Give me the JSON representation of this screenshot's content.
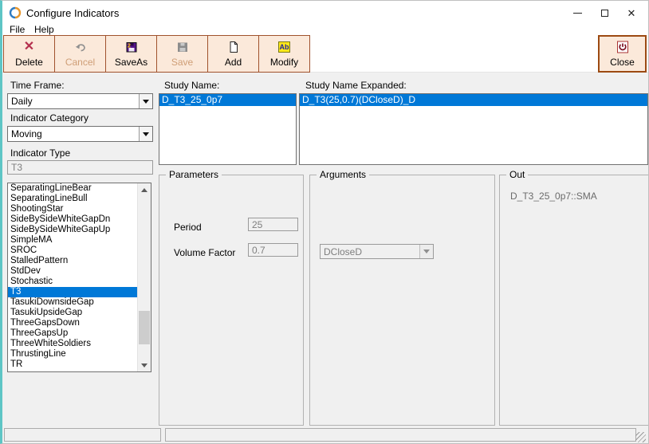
{
  "window": {
    "title": "Configure Indicators"
  },
  "menu": {
    "file": "File",
    "help": "Help"
  },
  "toolbar": {
    "delete_label": "Delete",
    "cancel_label": "Cancel",
    "save_as_label": "SaveAs",
    "save_label": "Save",
    "add_label": "Add",
    "modify_label": "Modify",
    "close_label": "Close",
    "modify_glyph": "Ab",
    "delete_glyph": "✕"
  },
  "form": {
    "time_frame_label": "Time Frame:",
    "time_frame_value": "Daily",
    "indicator_category_label": "Indicator Category",
    "indicator_category_value": "Moving",
    "indicator_type_label": "Indicator Type",
    "indicator_type_value": "T3"
  },
  "indicator_list": {
    "items": [
      "SeparatingLineBear",
      "SeparatingLineBull",
      "ShootingStar",
      "SideBySideWhiteGapDn",
      "SideBySideWhiteGapUp",
      "SimpleMA",
      "SROC",
      "StalledPattern",
      "StdDev",
      "Stochastic",
      "T3",
      "TasukiDownsideGap",
      "TasukiUpsideGap",
      "ThreeGapsDown",
      "ThreeGapsUp",
      "ThreeWhiteSoldiers",
      "ThrustingLine",
      "TR"
    ],
    "selected": "T3"
  },
  "study_name": {
    "label": "Study Name:",
    "selected_item": "D_T3_25_0p7"
  },
  "study_name_expanded": {
    "label": "Study Name Expanded:",
    "selected_item": "D_T3(25,0.7)(DCloseD)_D"
  },
  "parameters": {
    "title": "Parameters",
    "period_label": "Period",
    "period_value": "25",
    "volume_factor_label": "Volume Factor",
    "volume_factor_value": "0.7"
  },
  "arguments_group": {
    "title": "Arguments",
    "input_value": "DCloseD"
  },
  "out_group": {
    "title": "Out",
    "value": "D_T3_25_0p7::SMA"
  },
  "colors": {
    "selection_blue": "#0078d7",
    "toolbar_button_bg": "#fbe9da",
    "toolbar_border": "#a0522d",
    "disabled_toolbar_text": "#cf9e76",
    "teal_window_edge": "#5ec5c5",
    "client_bg": "#f0f0f0",
    "delete_x": "#b4304e"
  }
}
